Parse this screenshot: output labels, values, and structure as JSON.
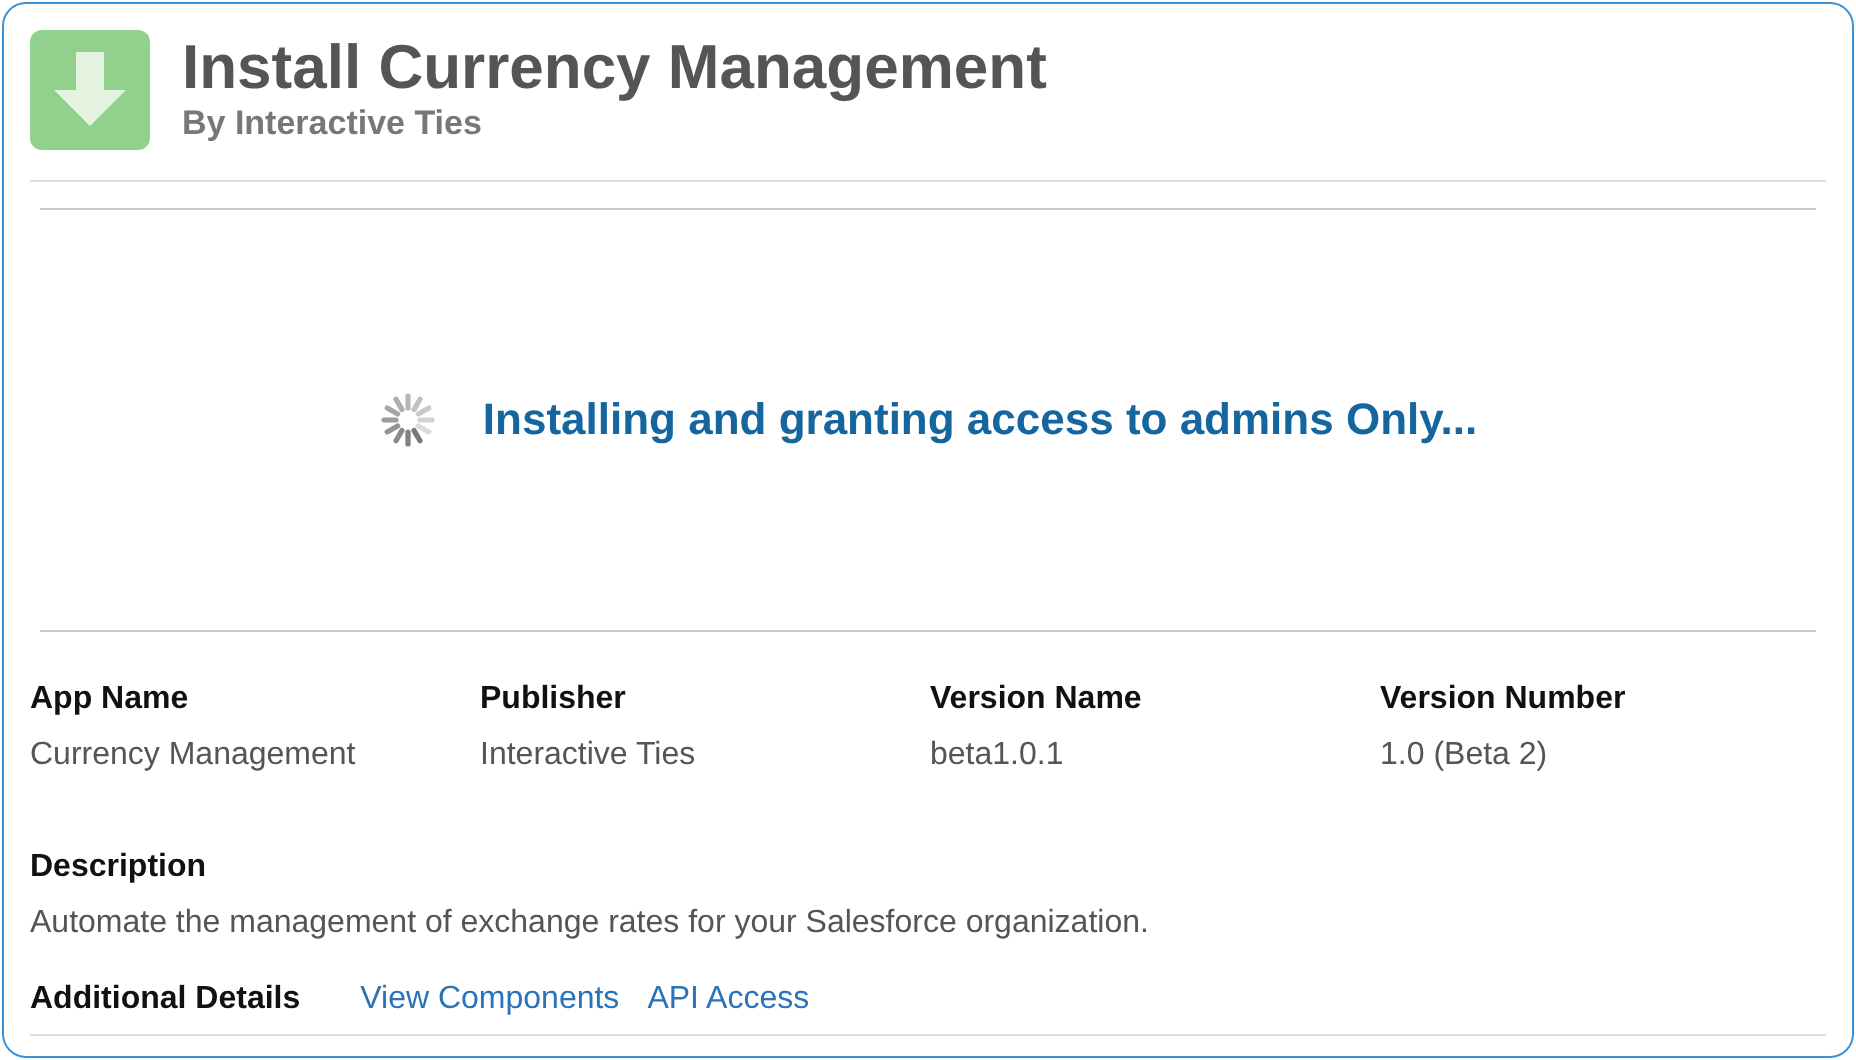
{
  "header": {
    "title": "Install Currency Management",
    "subtitle": "By Interactive Ties"
  },
  "status": {
    "message": "Installing and granting access to admins Only..."
  },
  "details": [
    {
      "label": "App Name",
      "value": "Currency Management"
    },
    {
      "label": "Publisher",
      "value": "Interactive Ties"
    },
    {
      "label": "Version Name",
      "value": "beta1.0.1"
    },
    {
      "label": "Version Number",
      "value": "1.0 (Beta 2)"
    }
  ],
  "description": {
    "label": "Description",
    "text": "Automate the management of exchange rates for your Salesforce organization."
  },
  "additional_details": {
    "label": "Additional Details",
    "links": [
      "View Components",
      "API Access"
    ]
  }
}
